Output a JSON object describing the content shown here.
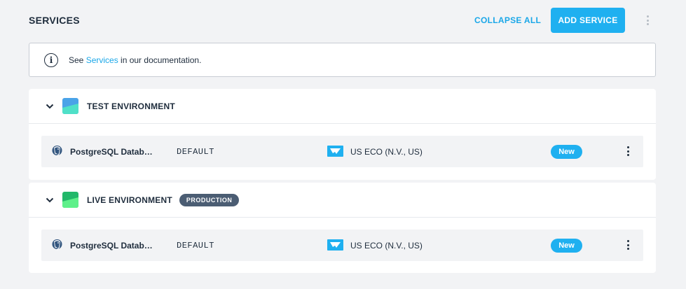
{
  "header": {
    "title": "SERVICES",
    "collapse_all": "COLLAPSE ALL",
    "add_service": "ADD SERVICE"
  },
  "info": {
    "prefix": "See ",
    "link": "Services",
    "suffix": " in our documentation."
  },
  "environments": [
    {
      "name": "TEST ENVIRONMENT",
      "badge": "",
      "logo_colors": [
        "#4aa3e8",
        "#4fe0c8"
      ],
      "services": [
        {
          "name": "PostgreSQL Datab…",
          "environment": "DEFAULT",
          "region": "US ECO (N.V., US)",
          "status": "New",
          "icon": "postgresql-icon",
          "region_icon": "region-flag-icon"
        }
      ]
    },
    {
      "name": "LIVE ENVIRONMENT",
      "badge": "PRODUCTION",
      "logo_colors": [
        "#22b86a",
        "#5ef08a"
      ],
      "services": [
        {
          "name": "PostgreSQL Datab…",
          "environment": "DEFAULT",
          "region": "US ECO (N.V., US)",
          "status": "New",
          "icon": "postgresql-icon",
          "region_icon": "region-flag-icon"
        }
      ]
    }
  ],
  "colors": {
    "accent": "#1fb0f0",
    "text": "#1f2d3d",
    "background": "#f2f3f5",
    "production_badge": "#4b5d73"
  }
}
